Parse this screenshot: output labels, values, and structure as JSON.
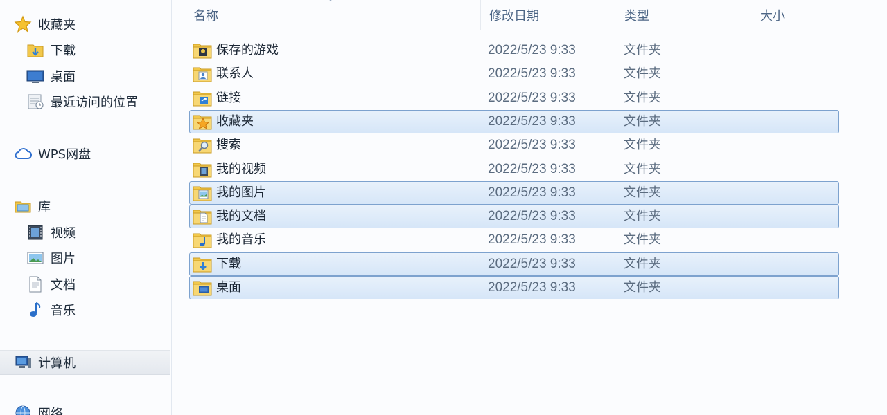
{
  "sidebar": {
    "favorites": {
      "label": "收藏夹",
      "icon": "star-icon",
      "items": [
        {
          "label": "下载",
          "icon": "downloads-folder-icon"
        },
        {
          "label": "桌面",
          "icon": "desktop-icon"
        },
        {
          "label": "最近访问的位置",
          "icon": "recent-places-icon"
        }
      ]
    },
    "wps": {
      "label": "WPS网盘",
      "icon": "cloud-icon"
    },
    "libraries": {
      "label": "库",
      "icon": "library-icon",
      "items": [
        {
          "label": "视频",
          "icon": "video-icon"
        },
        {
          "label": "图片",
          "icon": "picture-icon"
        },
        {
          "label": "文档",
          "icon": "document-icon"
        },
        {
          "label": "音乐",
          "icon": "music-icon"
        }
      ]
    },
    "computer": {
      "label": "计算机",
      "icon": "computer-icon"
    },
    "network": {
      "label": "网络",
      "icon": "network-icon"
    }
  },
  "columns": {
    "name": "名称",
    "modified": "修改日期",
    "type": "类型",
    "size": "大小",
    "sort_indicator": "˄"
  },
  "files": [
    {
      "name": "保存的游戏",
      "modified": "2022/5/23 9:33",
      "type": "文件夹",
      "selected": false,
      "icon": "saved-games-folder-icon"
    },
    {
      "name": "联系人",
      "modified": "2022/5/23 9:33",
      "type": "文件夹",
      "selected": false,
      "icon": "contacts-folder-icon"
    },
    {
      "name": "链接",
      "modified": "2022/5/23 9:33",
      "type": "文件夹",
      "selected": false,
      "icon": "links-folder-icon"
    },
    {
      "name": "收藏夹",
      "modified": "2022/5/23 9:33",
      "type": "文件夹",
      "selected": true,
      "icon": "favorites-folder-icon"
    },
    {
      "name": "搜索",
      "modified": "2022/5/23 9:33",
      "type": "文件夹",
      "selected": false,
      "icon": "searches-folder-icon"
    },
    {
      "name": "我的视频",
      "modified": "2022/5/23 9:33",
      "type": "文件夹",
      "selected": false,
      "icon": "videos-folder-icon"
    },
    {
      "name": "我的图片",
      "modified": "2022/5/23 9:33",
      "type": "文件夹",
      "selected": true,
      "icon": "pictures-folder-icon"
    },
    {
      "name": "我的文档",
      "modified": "2022/5/23 9:33",
      "type": "文件夹",
      "selected": true,
      "icon": "documents-folder-icon"
    },
    {
      "name": "我的音乐",
      "modified": "2022/5/23 9:33",
      "type": "文件夹",
      "selected": false,
      "icon": "music-folder-icon"
    },
    {
      "name": "下载",
      "modified": "2022/5/23 9:33",
      "type": "文件夹",
      "selected": true,
      "icon": "downloads-folder-icon"
    },
    {
      "name": "桌面",
      "modified": "2022/5/23 9:33",
      "type": "文件夹",
      "selected": true,
      "icon": "desktop-folder-icon"
    }
  ],
  "colors": {
    "selection_fill": "#dbe8f8",
    "selection_border": "#7da2ce",
    "folder": "#f2c84b"
  }
}
